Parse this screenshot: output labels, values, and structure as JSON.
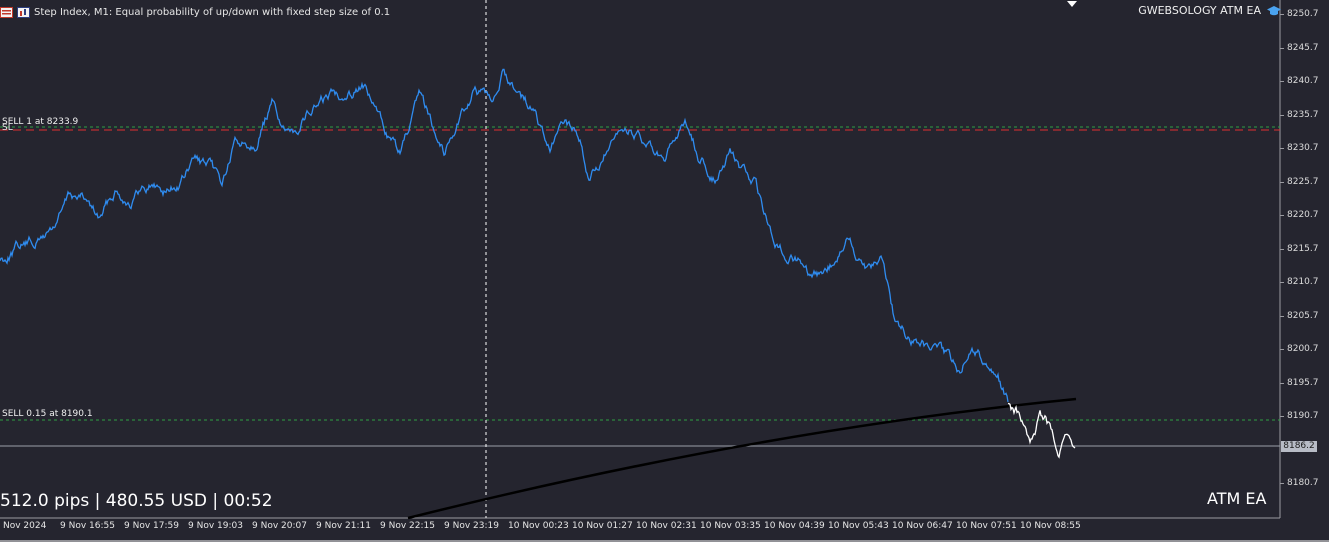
{
  "header": {
    "symbol_text": "Step Index, M1:  Equal probability of up/down with fixed step size of 0.1"
  },
  "ea": {
    "name": "GWEBSOLOGY ATM EA",
    "icon": "graduation-cap-icon"
  },
  "lines": {
    "sell1_label": "SELL 1 at 8233.9",
    "sl_label": "SL",
    "sell2_label": "SELL 0.15 at 8190.1"
  },
  "status": {
    "pips_text": "512.0 pips | 480.55 USD | 00:52",
    "atm_label": "ATM EA"
  },
  "price_tag": "8186.2",
  "price_axis": [
    "8250.7",
    "8245.7",
    "8240.7",
    "8235.7",
    "8230.7",
    "8225.7",
    "8220.7",
    "8215.7",
    "8210.7",
    "8205.7",
    "8200.7",
    "8195.7",
    "8190.7",
    "8186.2",
    "8180.7"
  ],
  "time_axis": [
    "Nov 2024",
    "9 Nov 16:55",
    "9 Nov 17:59",
    "9 Nov 19:03",
    "9 Nov 20:07",
    "9 Nov 21:11",
    "9 Nov 22:15",
    "9 Nov 23:19",
    "10 Nov 00:23",
    "10 Nov 01:27",
    "10 Nov 02:31",
    "10 Nov 03:35",
    "10 Nov 04:39",
    "10 Nov 05:43",
    "10 Nov 06:47",
    "10 Nov 07:51",
    "10 Nov 08:55"
  ],
  "colors": {
    "background": "#25252f",
    "price_line": "#2f8cf0",
    "recent_price_line": "#ffffff",
    "sell_line": "#2ea043",
    "sl_line": "#e03030",
    "trend_line": "#000000"
  }
}
